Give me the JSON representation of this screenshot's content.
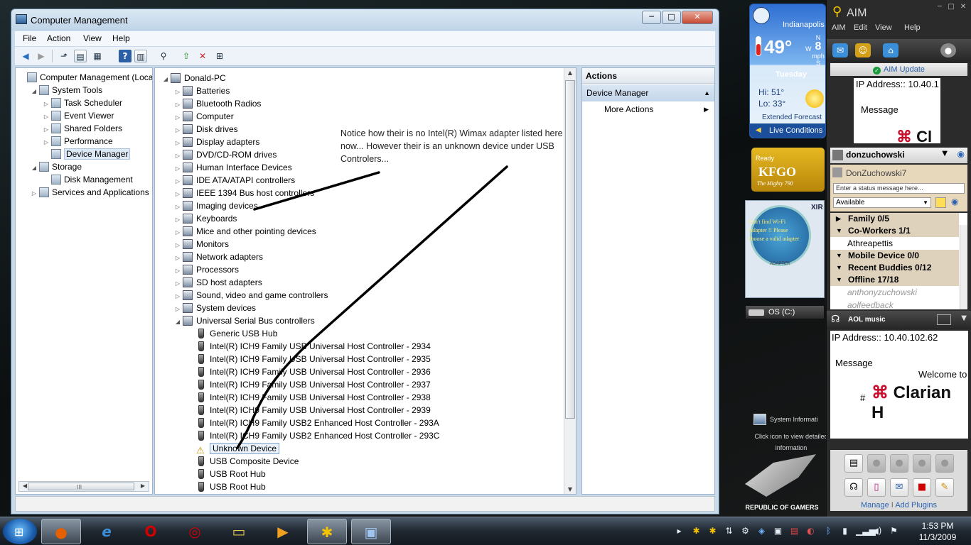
{
  "computer_management": {
    "title": "Computer Management",
    "buttons": {
      "minimize": "─",
      "maximize": "□",
      "close": "✕"
    },
    "menu": [
      "File",
      "Action",
      "View",
      "Help"
    ],
    "left_tree": [
      {
        "label": "Computer Management (Local",
        "level": 0,
        "expander": ""
      },
      {
        "label": "System Tools",
        "level": 1,
        "expander": "◢"
      },
      {
        "label": "Task Scheduler",
        "level": 2,
        "expander": "▷"
      },
      {
        "label": "Event Viewer",
        "level": 2,
        "expander": "▷"
      },
      {
        "label": "Shared Folders",
        "level": 2,
        "expander": "▷"
      },
      {
        "label": "Performance",
        "level": 2,
        "expander": "▷"
      },
      {
        "label": "Device Manager",
        "level": 2,
        "expander": "",
        "selected": true
      },
      {
        "label": "Storage",
        "level": 1,
        "expander": "◢"
      },
      {
        "label": "Disk Management",
        "level": 2,
        "expander": ""
      },
      {
        "label": "Services and Applications",
        "level": 1,
        "expander": "▷"
      }
    ],
    "scroll_thumb_label": "III",
    "device_tree": {
      "root": "Donald-PC",
      "categories": [
        "Batteries",
        "Bluetooth Radios",
        "Computer",
        "Disk drives",
        "Display adapters",
        "DVD/CD-ROM drives",
        "Human Interface Devices",
        "IDE ATA/ATAPI controllers",
        "IEEE 1394 Bus host controllers",
        "Imaging devices",
        "Keyboards",
        "Mice and other pointing devices",
        "Monitors",
        "Network adapters",
        "Processors",
        "SD host adapters",
        "Sound, video and game controllers",
        "System devices",
        "Universal Serial Bus controllers"
      ],
      "usb_children": [
        {
          "label": "Generic USB Hub"
        },
        {
          "label": "Intel(R) ICH9 Family USB Universal Host Controller - 2934"
        },
        {
          "label": "Intel(R) ICH9 Family USB Universal Host Controller - 2935"
        },
        {
          "label": "Intel(R) ICH9 Family USB Universal Host Controller - 2936"
        },
        {
          "label": "Intel(R) ICH9 Family USB Universal Host Controller - 2937"
        },
        {
          "label": "Intel(R) ICH9 Family USB Universal Host Controller - 2938"
        },
        {
          "label": "Intel(R) ICH9 Family USB Universal Host Controller - 2939"
        },
        {
          "label": "Intel(R) ICH9 Family USB2 Enhanced Host Controller - 293A"
        },
        {
          "label": "Intel(R) ICH9 Family USB2 Enhanced Host Controller - 293C"
        },
        {
          "label": "Unknown Device",
          "warning": true
        },
        {
          "label": "USB Composite Device"
        },
        {
          "label": "USB Root Hub"
        },
        {
          "label": "USB Root Hub"
        }
      ]
    },
    "annotation": "Notice how their is no Intel(R) Wimax adapter listed here now... However their is an unknown device under USB Controlers...",
    "actions": {
      "header": "Actions",
      "section": "Device Manager",
      "item": "More Actions"
    }
  },
  "weather": {
    "city": "Indianapolis..",
    "temp": "49°",
    "wind_dirs": {
      "n": "N",
      "w": "W",
      "s": "S"
    },
    "wind_speed": "8",
    "wind_unit": "mph",
    "day": "Tuesday",
    "hi": "Hi: 51°",
    "lo": "Lo: 33°",
    "extended": "Extended Forecast",
    "live": "Live Conditions"
  },
  "radio": {
    "small": "Ready",
    "big": "KFGO",
    "tag": "The Mighty 790"
  },
  "wifi": {
    "msg": "Can't find Wi-Fi Adapter !! Please choose a valid adapter",
    "brand": "XIR",
    "adapter": "ADAPTER"
  },
  "drive": {
    "label": "OS (C:)"
  },
  "sysinfo": {
    "title": "System Informati",
    "hint": "Click icon to view detailed information"
  },
  "rog": {
    "text": "REPUBLIC OF GAMERS"
  },
  "aim": {
    "title": "AIM",
    "menu": [
      "AIM",
      "Edit",
      "View",
      "Help"
    ],
    "update": "AIM Update",
    "ad_top": {
      "ip": "IP Address:: 10.40.1",
      "message": "Message",
      "brand": "Cl"
    },
    "screen_name": "donzuchowski",
    "display_name": "DonZuchowski7",
    "status_placeholder": "Enter a status message here...",
    "availability": "Available",
    "groups": [
      {
        "label": "Family 0/5",
        "open": false
      },
      {
        "label": "Co-Workers 1/1",
        "open": true,
        "buddies": [
          "Athreapettis"
        ],
        "offline": false
      },
      {
        "label": "Mobile Device 0/0",
        "open": true
      },
      {
        "label": "Recent Buddies 0/12",
        "open": true
      },
      {
        "label": "Offline 17/18",
        "open": true,
        "buddies": [
          "anthonyzuchowski",
          "aolfeedback"
        ],
        "offline": true
      }
    ],
    "music": "AOL music",
    "ad_bottom": {
      "ip": "IP Address:: 10.40.102.62",
      "message": "Message",
      "welcome": "Welcome to",
      "hash": "#",
      "brand": "Clarian H"
    },
    "links": {
      "manage": "Manage",
      "sep": "I",
      "add": "Add Plugins"
    }
  },
  "taskbar": {
    "clock_time": "1:53 PM",
    "clock_date": "11/3/2009"
  }
}
